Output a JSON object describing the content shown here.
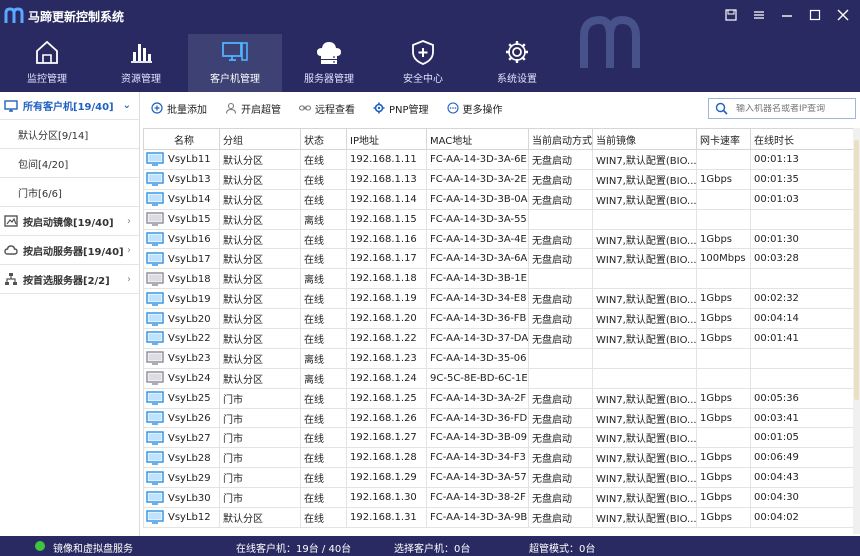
{
  "app": {
    "title": "马蹄更新控制系统"
  },
  "nav": {
    "tabs": [
      {
        "label": "监控管理",
        "icon": "home-monitor-icon"
      },
      {
        "label": "资源管理",
        "icon": "bar-chart-icon"
      },
      {
        "label": "客户机管理",
        "icon": "desktop-icon",
        "active": true
      },
      {
        "label": "服务器管理",
        "icon": "cloud-server-icon"
      },
      {
        "label": "安全中心",
        "icon": "shield-plus-icon"
      },
      {
        "label": "系统设置",
        "icon": "gear-icon"
      }
    ]
  },
  "sidebar": {
    "head": "所有客户机[19/40]",
    "groups": [
      "默认分区[9/14]",
      "包间[4/20]",
      "门市[6/6]"
    ],
    "sections": [
      "按启动镜像[19/40]",
      "按启动服务器[19/40]",
      "按首选服务器[2/2]"
    ]
  },
  "toolbar": {
    "batch_add": "批量添加",
    "super": "开启超管",
    "remote": "远程查看",
    "pnp": "PNP管理",
    "more": "更多操作",
    "search_placeholder": "输入机器名或者IP查询"
  },
  "table": {
    "headers": [
      "名称",
      "分组",
      "状态",
      "IP地址",
      "MAC地址",
      "当前启动方式",
      "当前镜像",
      "网卡速率",
      "在线时长"
    ],
    "rows": [
      [
        "VsyLb11",
        "默认分区",
        "在线",
        "192.168.1.11",
        "FC-AA-14-3D-3A-6E",
        "无盘启动",
        "WIN7,默认配置(BIO...",
        "",
        "00:01:13"
      ],
      [
        "VsyLb13",
        "默认分区",
        "在线",
        "192.168.1.13",
        "FC-AA-14-3D-3A-2E",
        "无盘启动",
        "WIN7,默认配置(BIO...",
        "1Gbps",
        "00:01:35"
      ],
      [
        "VsyLb14",
        "默认分区",
        "在线",
        "192.168.1.14",
        "FC-AA-14-3D-3B-0A",
        "无盘启动",
        "WIN7,默认配置(BIO...",
        "",
        "00:01:03"
      ],
      [
        "VsyLb15",
        "默认分区",
        "离线",
        "192.168.1.15",
        "FC-AA-14-3D-3A-55",
        "",
        "",
        "",
        ""
      ],
      [
        "VsyLb16",
        "默认分区",
        "在线",
        "192.168.1.16",
        "FC-AA-14-3D-3A-4E",
        "无盘启动",
        "WIN7,默认配置(BIO...",
        "1Gbps",
        "00:01:30"
      ],
      [
        "VsyLb17",
        "默认分区",
        "在线",
        "192.168.1.17",
        "FC-AA-14-3D-3A-6A",
        "无盘启动",
        "WIN7,默认配置(BIO...",
        "100Mbps",
        "00:03:28"
      ],
      [
        "VsyLb18",
        "默认分区",
        "离线",
        "192.168.1.18",
        "FC-AA-14-3D-3B-1E",
        "",
        "",
        "",
        ""
      ],
      [
        "VsyLb19",
        "默认分区",
        "在线",
        "192.168.1.19",
        "FC-AA-14-3D-34-E8",
        "无盘启动",
        "WIN7,默认配置(BIO...",
        "1Gbps",
        "00:02:32"
      ],
      [
        "VsyLb20",
        "默认分区",
        "在线",
        "192.168.1.20",
        "FC-AA-14-3D-36-FB",
        "无盘启动",
        "WIN7,默认配置(BIO...",
        "1Gbps",
        "00:04:14"
      ],
      [
        "VsyLb22",
        "默认分区",
        "在线",
        "192.168.1.22",
        "FC-AA-14-3D-37-DA",
        "无盘启动",
        "WIN7,默认配置(BIO...",
        "1Gbps",
        "00:01:41"
      ],
      [
        "VsyLb23",
        "默认分区",
        "离线",
        "192.168.1.23",
        "FC-AA-14-3D-35-06",
        "",
        "",
        "",
        ""
      ],
      [
        "VsyLb24",
        "默认分区",
        "离线",
        "192.168.1.24",
        "9C-5C-8E-BD-6C-1E",
        "",
        "",
        "",
        ""
      ],
      [
        "VsyLb25",
        "门市",
        "在线",
        "192.168.1.25",
        "FC-AA-14-3D-3A-2F",
        "无盘启动",
        "WIN7,默认配置(BIO...",
        "1Gbps",
        "00:05:36"
      ],
      [
        "VsyLb26",
        "门市",
        "在线",
        "192.168.1.26",
        "FC-AA-14-3D-36-FD",
        "无盘启动",
        "WIN7,默认配置(BIO...",
        "1Gbps",
        "00:03:41"
      ],
      [
        "VsyLb27",
        "门市",
        "在线",
        "192.168.1.27",
        "FC-AA-14-3D-3B-09",
        "无盘启动",
        "WIN7,默认配置(BIO...",
        "",
        "00:01:05"
      ],
      [
        "VsyLb28",
        "门市",
        "在线",
        "192.168.1.28",
        "FC-AA-14-3D-34-F3",
        "无盘启动",
        "WIN7,默认配置(BIO...",
        "1Gbps",
        "00:06:49"
      ],
      [
        "VsyLb29",
        "门市",
        "在线",
        "192.168.1.29",
        "FC-AA-14-3D-3A-57",
        "无盘启动",
        "WIN7,默认配置(BIO...",
        "1Gbps",
        "00:04:43"
      ],
      [
        "VsyLb30",
        "门市",
        "在线",
        "192.168.1.30",
        "FC-AA-14-3D-38-2F",
        "无盘启动",
        "WIN7,默认配置(BIO...",
        "1Gbps",
        "00:04:30"
      ],
      [
        "VsyLb12",
        "默认分区",
        "在线",
        "192.168.1.31",
        "FC-AA-14-3D-3A-9B",
        "无盘启动",
        "WIN7,默认配置(BIO...",
        "1Gbps",
        "00:04:02"
      ]
    ]
  },
  "status": {
    "service": "镜像和虚拟盘服务",
    "online": "在线客户机：19台 / 40台",
    "selected": "选择客户机：0台",
    "super_mode": "超管模式：0台"
  },
  "colors": {
    "header_bg": "#2a2a62",
    "accent": "#2060c0",
    "online_dot": "#3ec43e"
  }
}
